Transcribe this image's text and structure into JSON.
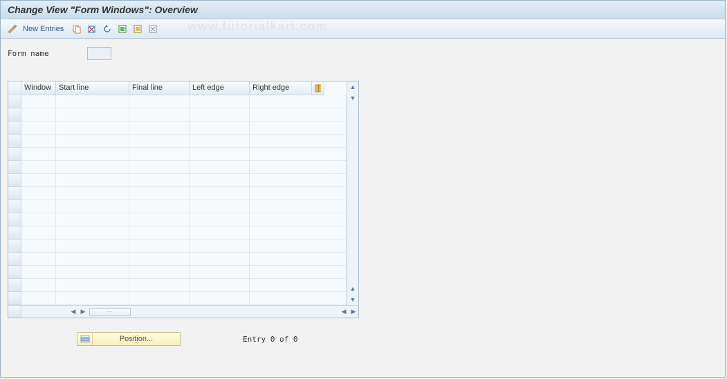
{
  "title": "Change View \"Form Windows\": Overview",
  "toolbar": {
    "new_entries_label": "New Entries"
  },
  "watermark": "www.tutorialkart.com",
  "form": {
    "name_label": "Form name",
    "name_value": ""
  },
  "table": {
    "columns": {
      "window": "Window",
      "start_line": "Start line",
      "final_line": "Final line",
      "left_edge": "Left edge",
      "right_edge": "Right edge"
    },
    "rows": [
      {
        "window": "",
        "start": "",
        "final": "",
        "left": "",
        "right": ""
      },
      {
        "window": "",
        "start": "",
        "final": "",
        "left": "",
        "right": ""
      },
      {
        "window": "",
        "start": "",
        "final": "",
        "left": "",
        "right": ""
      },
      {
        "window": "",
        "start": "",
        "final": "",
        "left": "",
        "right": ""
      },
      {
        "window": "",
        "start": "",
        "final": "",
        "left": "",
        "right": ""
      },
      {
        "window": "",
        "start": "",
        "final": "",
        "left": "",
        "right": ""
      },
      {
        "window": "",
        "start": "",
        "final": "",
        "left": "",
        "right": ""
      },
      {
        "window": "",
        "start": "",
        "final": "",
        "left": "",
        "right": ""
      },
      {
        "window": "",
        "start": "",
        "final": "",
        "left": "",
        "right": ""
      },
      {
        "window": "",
        "start": "",
        "final": "",
        "left": "",
        "right": ""
      },
      {
        "window": "",
        "start": "",
        "final": "",
        "left": "",
        "right": ""
      },
      {
        "window": "",
        "start": "",
        "final": "",
        "left": "",
        "right": ""
      },
      {
        "window": "",
        "start": "",
        "final": "",
        "left": "",
        "right": ""
      },
      {
        "window": "",
        "start": "",
        "final": "",
        "left": "",
        "right": ""
      },
      {
        "window": "",
        "start": "",
        "final": "",
        "left": "",
        "right": ""
      },
      {
        "window": "",
        "start": "",
        "final": "",
        "left": "",
        "right": ""
      }
    ]
  },
  "footer": {
    "position_label": "Position...",
    "entry_text": "Entry 0 of 0"
  }
}
